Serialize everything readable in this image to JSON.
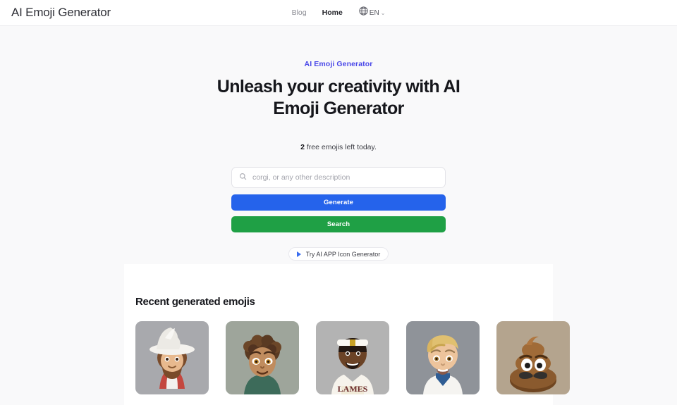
{
  "header": {
    "brand": "AI Emoji Generator",
    "nav": [
      {
        "label": "Blog",
        "active": false,
        "name": "nav-link-blog"
      },
      {
        "label": "Home",
        "active": true,
        "name": "nav-link-home"
      }
    ],
    "language": {
      "icon": "globe-icon",
      "label": "EN",
      "chevron": "⌄"
    }
  },
  "hero": {
    "eyebrow": "AI Emoji Generator",
    "eyebrow_color": "#4a48e8",
    "headline": "Unleash your creativity with AI Emoji Generator",
    "quota_count": "2",
    "quota_text": " free emojis left today."
  },
  "form": {
    "search_icon": "search-icon",
    "input_value": "",
    "input_placeholder": "corgi, or any other description",
    "generate_label": "Generate",
    "generate_color": "#2563eb",
    "search_label": "Search",
    "search_color": "#1fa045",
    "promo_label": "Try AI APP Icon Generator",
    "promo_icon": "play-triangle-icon",
    "promo_icon_color": "#3b6ef0"
  },
  "recent": {
    "title": "Recent generated emojis",
    "cards": [
      {
        "name": "emoji-card-wizard-hat-man",
        "alt": "Bearded man wearing a white wizard hat",
        "bg": "#a8a9ad",
        "skin": "#e8b98e",
        "hair": "#7a4b2a",
        "accent": "#f2f0ec"
      },
      {
        "name": "emoji-card-curly-hair-person",
        "alt": "Person with short curly brown hair",
        "bg": "#9ea59b",
        "skin": "#c08c5e",
        "hair": "#5a3a22",
        "accent": "#3d6b5a"
      },
      {
        "name": "emoji-card-basketball-player",
        "alt": "Basketball player in white and gold jersey",
        "bg": "#b3b3b3",
        "skin": "#6b4326",
        "hair": "#241812",
        "accent": "#f7e08a"
      },
      {
        "name": "emoji-card-blond-man-lab-coat",
        "alt": "Blond man in a white coat",
        "bg": "#8f9399",
        "skin": "#edc49c",
        "hair": "#e0c070",
        "accent": "#2f5d94"
      },
      {
        "name": "emoji-card-poop-mustache",
        "alt": "Pile of poo emoji with a mustache",
        "bg": "#b4a48e",
        "skin": "#8a5a33",
        "hair": "#3a3a3a",
        "accent": "#ffffff"
      }
    ]
  }
}
